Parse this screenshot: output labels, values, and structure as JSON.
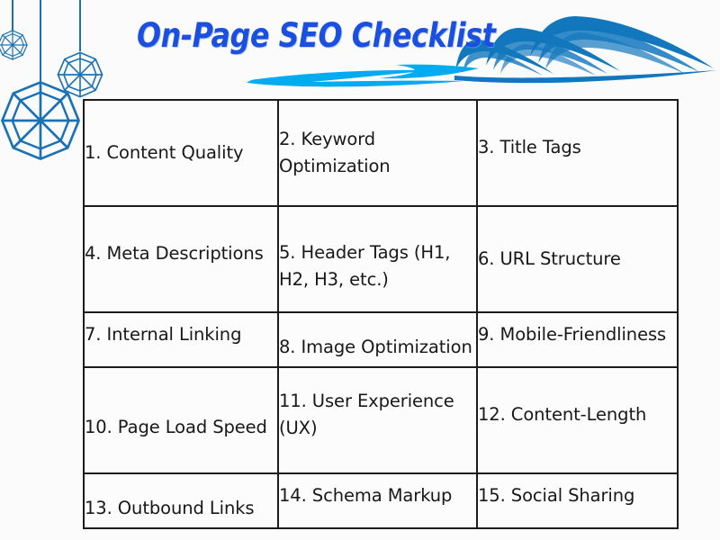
{
  "page": {
    "title": "On-Page SEO Checklist",
    "background_color": "#fbfbfb"
  },
  "decor": {
    "title_color": "#1a4fe0",
    "swoosh_color": "#00abef",
    "wave_color": "#1277bd",
    "ornament_color": "#1a72b5",
    "ornaments_icon": "hanging-ornaments-icon",
    "wave_icon": "wave-icon",
    "swoosh_icon": "swoosh-underline-icon"
  },
  "checklist": {
    "border_color": "#1c1c1c",
    "cell_background": "#fcfcfc",
    "text_color": "#181818",
    "rows": [
      [
        {
          "id": "1",
          "label": "1. Content Quality"
        },
        {
          "id": "2",
          "label": "2. Keyword Optimization"
        },
        {
          "id": "3",
          "label": "3. Title Tags"
        }
      ],
      [
        {
          "id": "4",
          "label": "4. Meta Descriptions"
        },
        {
          "id": "5",
          "label": "5. Header Tags (H1, H2, H3, etc.)"
        },
        {
          "id": "6",
          "label": "6. URL Structure"
        }
      ],
      [
        {
          "id": "7",
          "label": "7. Internal Linking"
        },
        {
          "id": "8",
          "label": "8. Image Optimization"
        },
        {
          "id": "9",
          "label": "9. Mobile-Friendliness"
        }
      ],
      [
        {
          "id": "10",
          "label": "10. Page Load Speed"
        },
        {
          "id": "11",
          "label": "11. User Experience (UX)"
        },
        {
          "id": "12",
          "label": "12. Content-Length"
        }
      ],
      [
        {
          "id": "13",
          "label": "13. Outbound Links"
        },
        {
          "id": "14",
          "label": "14. Schema Markup"
        },
        {
          "id": "15",
          "label": "15. Social Sharing"
        }
      ]
    ]
  }
}
